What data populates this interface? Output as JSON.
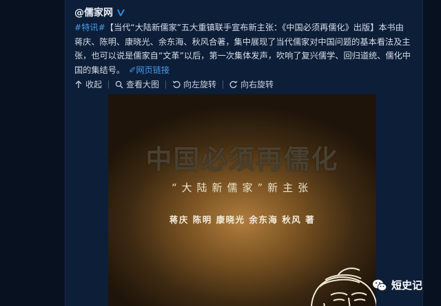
{
  "post": {
    "author": "@儒家网",
    "hashtag": "#特讯#",
    "body": "【当代“大陆新儒家”五大重镇联手宣布新主张：《中国必须再儒化》出版】本书由蒋庆、陈明、康晓光、余东海、秋风合著，集中展现了当代儒家对中国问题的基本看法及主张，也可以说是儒家自“文革”以后，第一次集体发声，吹响了复兴儒学、回归道统、儒化中国的集结号。",
    "weblink": "网页链接"
  },
  "toolbar": {
    "collapse": "收起",
    "view_large": "查看大图",
    "rotate_left": "向左旋转",
    "rotate_right": "向右旋转"
  },
  "cover": {
    "title": "中国必须再儒化",
    "subtitle": "“大陆新儒家”新主张",
    "authors": "蒋庆 陈明 康晓光 余东海 秋风 著"
  },
  "watermark": {
    "label": "短史记"
  },
  "icons": {
    "verified": "verified-v-icon",
    "link": "link-icon",
    "collapse": "arrow-up-icon",
    "view_large": "magnifier-icon",
    "rotate_left": "rotate-left-icon",
    "rotate_right": "rotate-right-icon",
    "watermark": "wechat-icon"
  },
  "colors": {
    "background": "#07111f",
    "panel": "#0d1e38",
    "link": "#4a9be8",
    "text": "#d5dde8",
    "verified": "#2a8fe8"
  }
}
